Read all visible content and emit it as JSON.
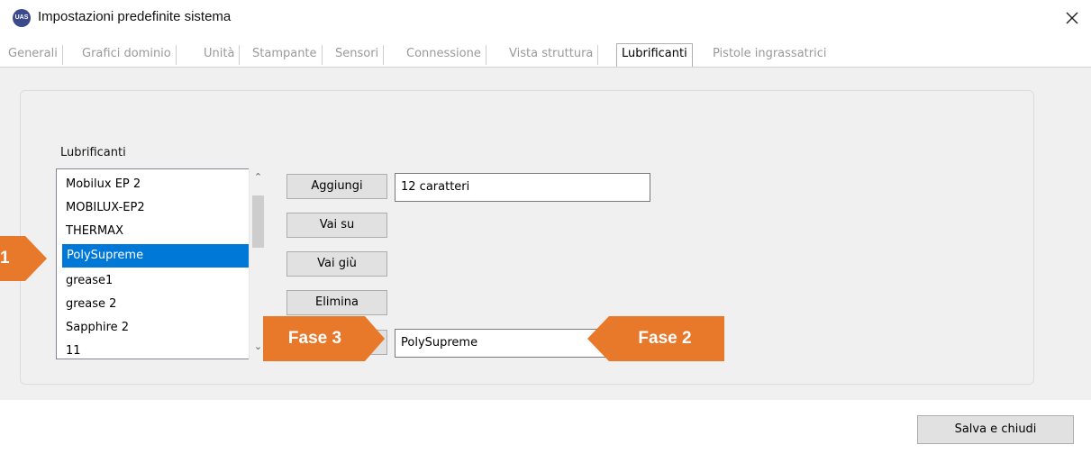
{
  "window": {
    "app_icon_text": "UAS",
    "title": "Impostazioni predefinite sistema"
  },
  "tabs": [
    {
      "label": "Generali",
      "active": false
    },
    {
      "label": "Grafici dominio",
      "active": false
    },
    {
      "label": "Unità",
      "active": false
    },
    {
      "label": "Stampante",
      "active": false
    },
    {
      "label": "Sensori",
      "active": false
    },
    {
      "label": "Connessione",
      "active": false
    },
    {
      "label": "Vista struttura",
      "active": false
    },
    {
      "label": "Lubrificanti",
      "active": true
    },
    {
      "label": "Pistole ingrassatrici",
      "active": false
    }
  ],
  "lubricants": {
    "label": "Lubrificanti",
    "items": [
      "Mobilux EP 2",
      "MOBILUX-EP2",
      "THERMAX",
      "PolySupreme",
      "grease1",
      "grease 2",
      "Sapphire 2",
      "11"
    ],
    "selected": "PolySupreme"
  },
  "buttons": {
    "add": "Aggiungi",
    "move_up": "Vai su",
    "move_down": "Vai giù",
    "delete": "Elimina",
    "save_close": "Salva e chiudi"
  },
  "fields": {
    "new_name_value": "12 caratteri",
    "edit_name_value": "PolySupreme"
  },
  "callouts": {
    "step1": "1",
    "step2": "Fase 2",
    "step3": "Fase 3"
  },
  "colors": {
    "callout": "#e8782a",
    "selection": "#0078d7"
  }
}
